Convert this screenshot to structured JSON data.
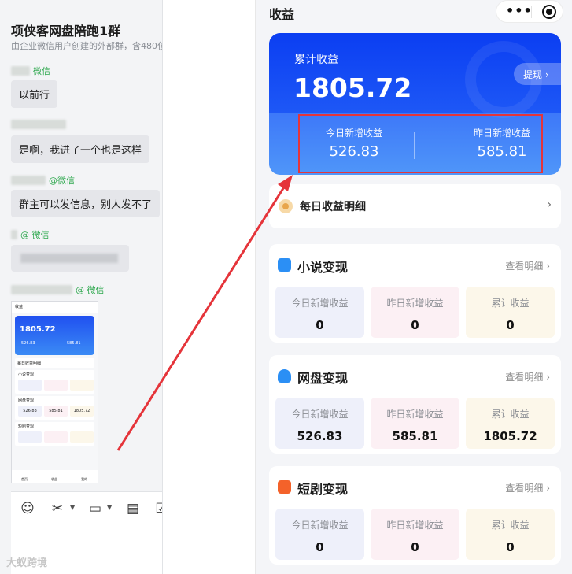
{
  "chat": {
    "title": "项侠客网盘陪跑1群",
    "subtitle": "由企业微信用户创建的外部群，含480位外",
    "messages": [
      {
        "sender": "微信",
        "text": "以前行"
      },
      {
        "sender": "",
        "text": "是啊，我进了一个也是这样"
      },
      {
        "sender": "@微信",
        "text": "群主可以发信息，别人发不了"
      },
      {
        "sender": "@ 微信",
        "text": ""
      },
      {
        "sender": "@ 微信",
        "text": ""
      }
    ],
    "watermark": "大蚁跨境"
  },
  "thumbnail": {
    "title": "收益",
    "total": "1805.72",
    "today": "526.83",
    "yesterday": "585.81",
    "daily": "每日收益明细",
    "sections": [
      "小说变现",
      "网盘变现",
      "短剧变现"
    ],
    "wangpan_values": [
      "526.83",
      "585.81",
      "1805.72"
    ],
    "nav": [
      "首页",
      "收益",
      "我的"
    ]
  },
  "page": {
    "title": "收益",
    "hero": {
      "total_label": "累计收益",
      "total_value": "1805.72",
      "withdraw_label": "提现",
      "today_label": "今日新增收益",
      "today_value": "526.83",
      "yesterday_label": "昨日新增收益",
      "yesterday_value": "585.81"
    },
    "daily_detail": "每日收益明细",
    "more_label": "查看明细",
    "sections": [
      {
        "title": "小说变现",
        "icon": "book-icon",
        "icon_color": "#2b8ff5",
        "today_label": "今日新增收益",
        "today": "0",
        "yesterday_label": "昨日新增收益",
        "yesterday": "0",
        "total_label": "累计收益",
        "total": "0"
      },
      {
        "title": "网盘变现",
        "icon": "cloud-upload-icon",
        "icon_color": "#2b8ff5",
        "today_label": "今日新增收益",
        "today": "526.83",
        "yesterday_label": "昨日新增收益",
        "yesterday": "585.81",
        "total_label": "累计收益",
        "total": "1805.72"
      },
      {
        "title": "短剧变现",
        "icon": "play-icon",
        "icon_color": "#f4622a",
        "today_label": "今日新增收益",
        "today": "0",
        "yesterday_label": "昨日新增收益",
        "yesterday": "0",
        "total_label": "累计收益",
        "total": "0"
      }
    ]
  },
  "colors": {
    "hero_blue": "#1d57f6",
    "highlight_red": "#e5343a",
    "sender_green": "#2fa84f"
  }
}
